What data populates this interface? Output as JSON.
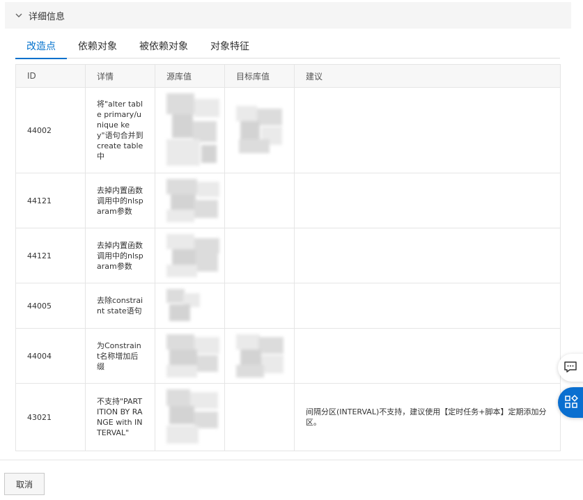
{
  "section": {
    "title": "详细信息",
    "chevron_icon": "chevron-down-icon"
  },
  "tabs": [
    {
      "label": "改造点",
      "active": true
    },
    {
      "label": "依赖对象",
      "active": false
    },
    {
      "label": "被依赖对象",
      "active": false
    },
    {
      "label": "对象特征",
      "active": false
    }
  ],
  "table": {
    "headers": {
      "id": "ID",
      "detail": "详情",
      "source": "源库值",
      "target": "目标库值",
      "suggestion": "建议"
    },
    "rows": [
      {
        "id": "44002",
        "detail": "将\"alter table primary/unique key\"语句合并到create table中",
        "source_redacted": true,
        "target_redacted": true,
        "suggestion": ""
      },
      {
        "id": "44121",
        "detail": "去掉内置函数调用中的nlsparam参数",
        "source_redacted": true,
        "target_redacted": false,
        "suggestion": ""
      },
      {
        "id": "44121",
        "detail": "去掉内置函数调用中的nlsparam参数",
        "source_redacted": true,
        "target_redacted": false,
        "suggestion": ""
      },
      {
        "id": "44005",
        "detail": "去除constraint state语句",
        "source_redacted": true,
        "target_redacted": false,
        "suggestion": ""
      },
      {
        "id": "44004",
        "detail": "为Constraint名称增加后缀",
        "source_redacted": true,
        "target_redacted": true,
        "suggestion": ""
      },
      {
        "id": "43021",
        "detail": "不支持\"PARTITION BY RANGE with INTERVAL\"",
        "source_redacted": true,
        "target_redacted": false,
        "suggestion": "间隔分区(INTERVAL)不支持，建议使用【定时任务+脚本】定期添加分区。"
      }
    ]
  },
  "floating": {
    "message_icon": "message-icon",
    "apps_icon": "apps-icon",
    "accent_color": "#0a6fd0"
  },
  "footer": {
    "cancel_label": "取消"
  },
  "colors": {
    "active_tab": "#0070cc",
    "header_bg": "#f5f5f5"
  }
}
